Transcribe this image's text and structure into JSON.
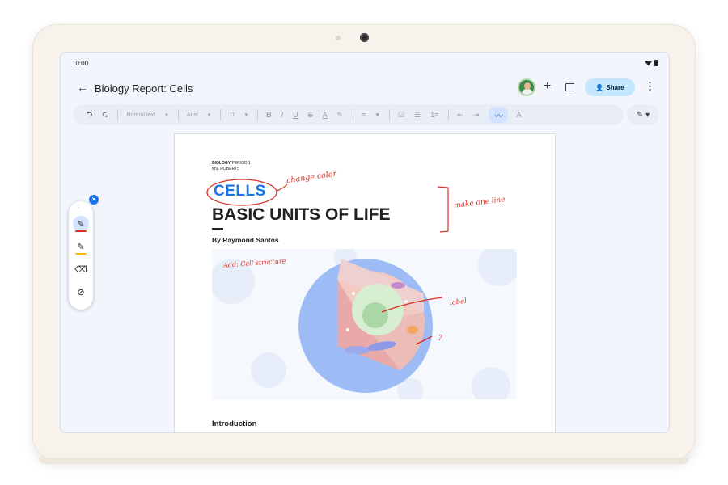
{
  "status_bar": {
    "time": "10:00"
  },
  "app": {
    "back_icon": "arrow-left-icon",
    "title": "Biology Report: Cells",
    "share_label": "Share"
  },
  "toolbar": {
    "undo": "⮌",
    "redo": "⮎",
    "style": "Normal text",
    "font": "Arial",
    "size": "11",
    "bold": "B",
    "italic": "I",
    "underline": "U",
    "strike": "S",
    "text_color": "A",
    "highlight": "✎",
    "align": "≡",
    "checklist": "☑",
    "bullets": "☰",
    "numbered": "1≡",
    "indent_less": "⇤",
    "indent_more": "⇥",
    "clear_format": "A",
    "pen_tool": "✎ ▾"
  },
  "document": {
    "class_label": "BIOLOGY",
    "class_period": " PERIOD 1",
    "teacher": "MS. ROBERTS",
    "heading": "CELLS",
    "subheading": "BASIC UNITS OF LIFE",
    "byline": "By Raymond Santos",
    "section_title": "Introduction"
  },
  "annotations": {
    "change_color": "change color",
    "one_line": "make one line",
    "add_structure": "Add: Cell structure",
    "label": "label",
    "question": "?"
  },
  "pen_palette": {
    "tools": [
      "pen",
      "highlighter",
      "eraser",
      "hide-ink"
    ],
    "pen_color": "#d93025",
    "highlighter_color": "#fbbc04"
  },
  "colors": {
    "accent": "#1a73e8",
    "share_bg": "#c2e7ff",
    "ink": "#d93025"
  }
}
